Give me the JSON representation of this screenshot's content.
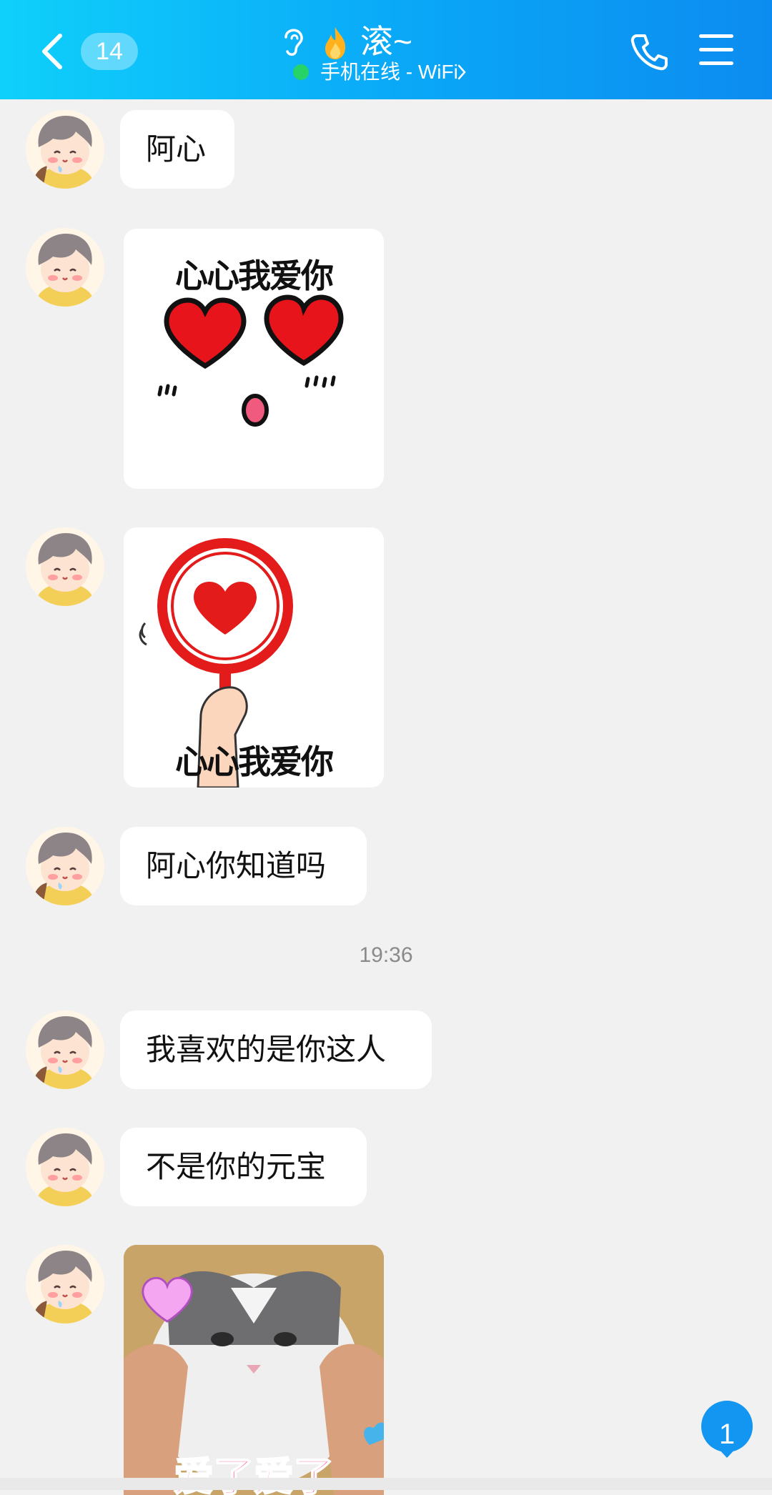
{
  "header": {
    "unread_count": "14",
    "chat_name": "滚~",
    "status": "手机在线 - WiFi",
    "colors": {
      "accent_start": "#0fd0fb",
      "accent_end": "#0c8cf0",
      "online": "#25d366"
    },
    "icons": [
      "back-chevron-icon",
      "ear-icon",
      "flame-icon",
      "phone-icon",
      "menu-icon",
      "chevron-right-icon"
    ]
  },
  "messages": [
    {
      "type": "text",
      "text": "阿心"
    },
    {
      "type": "sticker",
      "text": "心心我爱你"
    },
    {
      "type": "sticker",
      "text": "心心我爱你"
    },
    {
      "type": "text",
      "text": "阿心你知道吗"
    },
    {
      "type": "timestamp",
      "text": "19:36"
    },
    {
      "type": "text",
      "text": "我喜欢的是你这人"
    },
    {
      "type": "text",
      "text": "不是你的元宝"
    },
    {
      "type": "sticker",
      "text": "爱了爱了"
    }
  ],
  "new_messages": {
    "count": "1"
  }
}
